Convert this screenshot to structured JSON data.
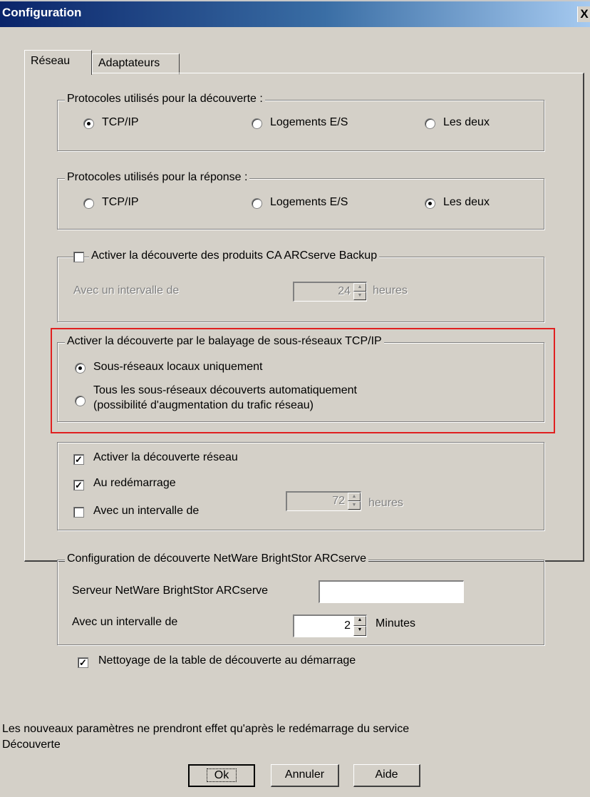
{
  "window": {
    "title": "Configuration",
    "close_glyph": "X"
  },
  "tabs": [
    {
      "label": "Réseau",
      "selected": true
    },
    {
      "label": "Adaptateurs",
      "selected": false
    }
  ],
  "discovery_protocols": {
    "legend": "Protocoles utilisés pour la découverte :",
    "options": [
      "TCP/IP",
      "Logements E/S",
      "Les deux"
    ],
    "selected": "TCP/IP"
  },
  "response_protocols": {
    "legend": "Protocoles utilisés pour la réponse :",
    "options": [
      "TCP/IP",
      "Logements E/S",
      "Les deux"
    ],
    "selected": "Les deux"
  },
  "ca_discovery": {
    "checkbox_label": "Activer la découverte des produits CA ARCserve Backup",
    "checked": false,
    "interval_label": "Avec un intervalle de",
    "interval_value": "24",
    "interval_unit": "heures"
  },
  "subnet_sweep": {
    "legend": "Activer la découverte par le balayage de sous-réseaux TCP/IP",
    "option_local": "Sous-réseaux locaux uniquement",
    "option_all_line1": "Tous les sous-réseaux découverts automatiquement",
    "option_all_line2": "(possibilité d'augmentation du trafic réseau)",
    "selected": "local"
  },
  "network_discovery": {
    "enable_label": "Activer la découverte réseau",
    "enable_checked": true,
    "restart_label": "Au redémarrage",
    "restart_checked": true,
    "interval_label": "Avec un intervalle de",
    "interval_checked": false,
    "interval_value": "72",
    "interval_unit": "heures"
  },
  "netware_config": {
    "legend": "Configuration de découverte NetWare BrightStor ARCserve",
    "server_label": "Serveur NetWare BrightStor ARCserve",
    "server_value": "",
    "interval_label": "Avec un intervalle de",
    "interval_value": "2",
    "interval_unit": "Minutes"
  },
  "cleanup": {
    "label": "Nettoyage de la table de découverte au démarrage",
    "checked": true
  },
  "notice": {
    "line1": "Les nouveaux paramètres ne prendront effet qu'après le redémarrage du service",
    "line2": "Découverte"
  },
  "buttons": {
    "ok": "Ok",
    "cancel": "Annuler",
    "help": "Aide"
  },
  "colors": {
    "titlebar_start": "#0a246a",
    "titlebar_end": "#a6caf0",
    "highlight": "#e02020",
    "face": "#d4d0c8"
  }
}
